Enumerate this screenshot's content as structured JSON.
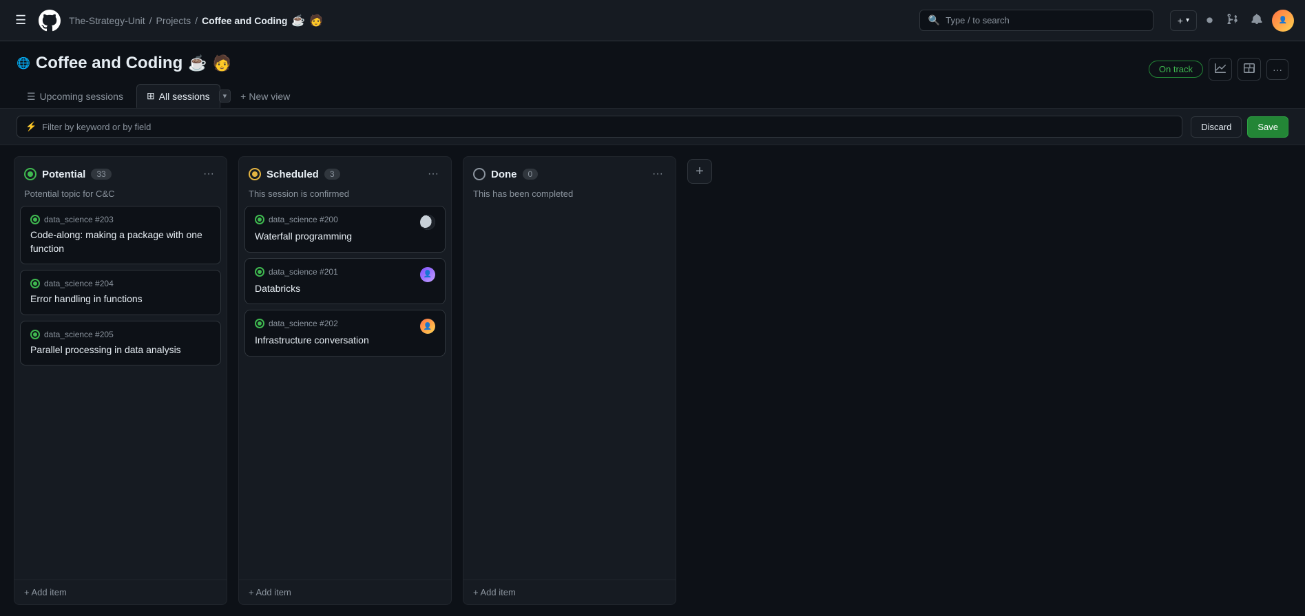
{
  "nav": {
    "org": "The-Strategy-Unit",
    "sep1": "/",
    "section": "Projects",
    "sep2": "/",
    "project": "Coffee and Coding",
    "search_placeholder": "Type / to search",
    "new_btn": "+",
    "hamburger_label": "☰"
  },
  "page": {
    "title": "Coffee and Coding",
    "title_emoji1": "☕",
    "title_emoji2": "🧑",
    "globe_icon": "🌐",
    "on_track_label": "On track"
  },
  "tabs": {
    "upcoming": "Upcoming sessions",
    "all": "All sessions",
    "new_view": "New view"
  },
  "filter": {
    "placeholder": "Filter by keyword or by field",
    "discard_label": "Discard",
    "save_label": "Save"
  },
  "columns": [
    {
      "id": "potential",
      "name": "Potential",
      "count": "33",
      "description": "Potential topic for C&C",
      "status": "potential",
      "cards": [
        {
          "repo": "data_science #203",
          "title": "Code-along: making a package with one function",
          "has_avatar": false
        },
        {
          "repo": "data_science #204",
          "title": "Error handling in functions",
          "has_avatar": false
        },
        {
          "repo": "data_science #205",
          "title": "Parallel processing in data analysis",
          "has_avatar": false
        }
      ],
      "add_item": "+ Add item"
    },
    {
      "id": "scheduled",
      "name": "Scheduled",
      "count": "3",
      "description": "This session is confirmed",
      "status": "scheduled",
      "cards": [
        {
          "repo": "data_science #200",
          "title": "Waterfall programming",
          "has_avatar": true,
          "avatar_style": "moon"
        },
        {
          "repo": "data_science #201",
          "title": "Databricks",
          "has_avatar": true,
          "avatar_style": "person1"
        },
        {
          "repo": "data_science #202",
          "title": "Infrastructure conversation",
          "has_avatar": true,
          "avatar_style": "person2"
        }
      ],
      "add_item": "+ Add item"
    },
    {
      "id": "done",
      "name": "Done",
      "count": "0",
      "description": "This has been completed",
      "status": "done",
      "cards": [],
      "add_item": "+ Add item"
    }
  ]
}
